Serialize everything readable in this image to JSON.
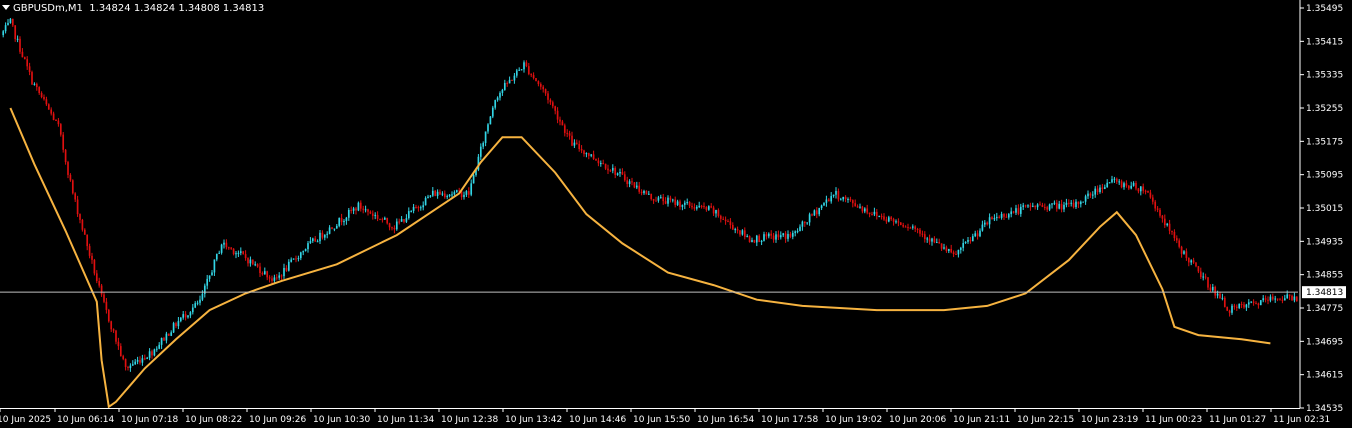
{
  "header": {
    "symbol": "GBPUSDm,M1",
    "ohlc": "1.34824 1.34824 1.34808 1.34813"
  },
  "colors": {
    "background": "#000000",
    "bull": "#33d6e6",
    "bear": "#e01010",
    "ma": "#f6b340",
    "axis": "#ffffff",
    "price_line": "#c0c0c0"
  },
  "chart_data": {
    "type": "candlestick",
    "symbol": "GBPUSDm",
    "timeframe": "M1",
    "current_price": "1.34813",
    "ylim": [
      1.34535,
      1.35495
    ],
    "y_ticks": [
      "1.35495",
      "1.35415",
      "1.35335",
      "1.35255",
      "1.35175",
      "1.35095",
      "1.35015",
      "1.34935",
      "1.34855",
      "1.34775",
      "1.34695",
      "1.34615",
      "1.34535"
    ],
    "x_ticks": [
      "10 Jun 2025",
      "10 Jun 06:14",
      "10 Jun 07:18",
      "10 Jun 08:22",
      "10 Jun 09:26",
      "10 Jun 10:30",
      "10 Jun 11:34",
      "10 Jun 12:38",
      "10 Jun 13:42",
      "10 Jun 14:46",
      "10 Jun 15:50",
      "10 Jun 16:54",
      "10 Jun 17:58",
      "10 Jun 19:02",
      "10 Jun 20:06",
      "10 Jun 21:11",
      "10 Jun 22:15",
      "10 Jun 23:19",
      "11 Jun 00:23",
      "11 Jun 01:27",
      "11 Jun 02:31"
    ],
    "price_anchors": [
      [
        0,
        1.3543
      ],
      [
        4,
        1.3546
      ],
      [
        13,
        1.3532
      ],
      [
        24,
        1.3521
      ],
      [
        30,
        1.3505
      ],
      [
        42,
        1.348
      ],
      [
        52,
        1.3463
      ],
      [
        63,
        1.3467
      ],
      [
        75,
        1.3475
      ],
      [
        83,
        1.3479
      ],
      [
        92,
        1.3493
      ],
      [
        101,
        1.349
      ],
      [
        114,
        1.3484
      ],
      [
        127,
        1.3492
      ],
      [
        149,
        1.3502
      ],
      [
        164,
        1.3497
      ],
      [
        180,
        1.3505
      ],
      [
        195,
        1.3505
      ],
      [
        206,
        1.3528
      ],
      [
        218,
        1.3536
      ],
      [
        227,
        1.3529
      ],
      [
        238,
        1.3517
      ],
      [
        254,
        1.3511
      ],
      [
        271,
        1.3504
      ],
      [
        296,
        1.3501
      ],
      [
        312,
        1.3494
      ],
      [
        330,
        1.3495
      ],
      [
        347,
        1.3505
      ],
      [
        364,
        1.35
      ],
      [
        380,
        1.3497
      ],
      [
        397,
        1.349
      ],
      [
        413,
        1.3499
      ],
      [
        430,
        1.3502
      ],
      [
        447,
        1.3502
      ],
      [
        462,
        1.3508
      ],
      [
        477,
        1.3506
      ],
      [
        491,
        1.3492
      ],
      [
        502,
        1.3484
      ],
      [
        512,
        1.3477
      ],
      [
        532,
        1.348
      ]
    ],
    "ma_series": [
      [
        3,
        1.35255
      ],
      [
        13,
        1.3512
      ],
      [
        26,
        1.3496
      ],
      [
        39,
        1.3479
      ],
      [
        41,
        1.3465
      ],
      [
        44,
        1.34538
      ],
      [
        47,
        1.3455
      ],
      [
        59,
        1.3463
      ],
      [
        72,
        1.347
      ],
      [
        86,
        1.3477
      ],
      [
        101,
        1.3481
      ],
      [
        116,
        1.3484
      ],
      [
        139,
        1.3488
      ],
      [
        164,
        1.3495
      ],
      [
        190,
        1.3505
      ],
      [
        199,
        1.35125
      ],
      [
        208,
        1.35185
      ],
      [
        216,
        1.35185
      ],
      [
        230,
        1.351
      ],
      [
        243,
        1.35
      ],
      [
        258,
        1.3493
      ],
      [
        277,
        1.3486
      ],
      [
        296,
        1.3483
      ],
      [
        314,
        1.34795
      ],
      [
        333,
        1.3478
      ],
      [
        364,
        1.3477
      ],
      [
        392,
        1.3477
      ],
      [
        410,
        1.3478
      ],
      [
        426,
        1.3481
      ],
      [
        444,
        1.3489
      ],
      [
        457,
        1.3497
      ],
      [
        464,
        1.35005
      ],
      [
        472,
        1.3495
      ],
      [
        483,
        1.3482
      ],
      [
        488,
        1.3473
      ],
      [
        498,
        1.3471
      ],
      [
        516,
        1.347
      ],
      [
        528,
        1.3469
      ]
    ]
  }
}
